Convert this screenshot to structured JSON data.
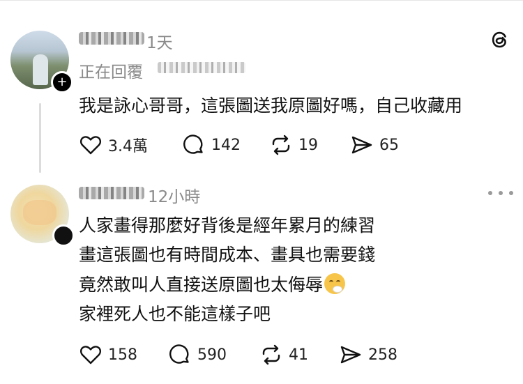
{
  "post1": {
    "time": "1天",
    "reply_label": "正在回覆",
    "text": "我是詠心哥哥，這張圖送我原圖好嗎，自己收藏用",
    "likes": "3.4萬",
    "comments": "142",
    "reposts": "19",
    "shares": "65"
  },
  "post2": {
    "time": "12小時",
    "lines": [
      "人家畫得那麼好背後是經年累月的練習",
      "畫這張圖也有時間成本、畫具也需要錢",
      "竟然敢叫人直接送原圖也太侮辱",
      "家裡死人也不能這樣子吧"
    ],
    "emoji": "face-exhaling-emoji",
    "likes": "158",
    "comments": "590",
    "reposts": "41",
    "shares": "258"
  },
  "icons": {
    "logo": "threads-logo-icon",
    "more": "more-options-icon",
    "like": "heart-icon",
    "comment": "comment-bubble-icon",
    "repost": "repost-icon",
    "share": "send-icon"
  }
}
